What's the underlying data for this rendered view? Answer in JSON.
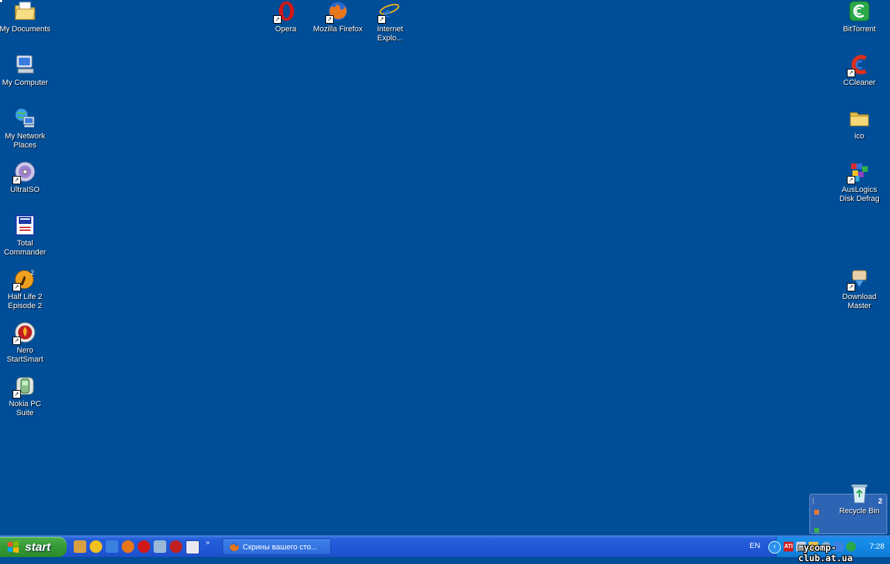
{
  "desktop": {
    "icons_left": [
      {
        "label": "My Documents",
        "icon": "my-documents-icon"
      },
      {
        "label": "My Computer",
        "icon": "my-computer-icon"
      },
      {
        "label": "My Network Places",
        "icon": "network-places-icon"
      },
      {
        "label": "UltraISO",
        "icon": "ultraiso-icon"
      },
      {
        "label": "Total Commander",
        "icon": "total-commander-icon"
      },
      {
        "label": "Half Life 2 Episode 2",
        "icon": "half-life-icon"
      },
      {
        "label": "Nero StartSmart",
        "icon": "nero-icon"
      },
      {
        "label": "Nokia PC Suite",
        "icon": "nokia-icon"
      }
    ],
    "icons_top": [
      {
        "label": "Opera",
        "icon": "opera-icon"
      },
      {
        "label": "Mozilla Firefox",
        "icon": "firefox-icon"
      },
      {
        "label": "Internet Explo...",
        "icon": "internet-explorer-icon"
      }
    ],
    "icons_right": [
      {
        "label": "BitTorrent",
        "icon": "bittorrent-icon"
      },
      {
        "label": "CCleaner",
        "icon": "ccleaner-icon"
      },
      {
        "label": "ico",
        "icon": "folder-icon"
      },
      {
        "label": "AusLogics Disk Defrag",
        "icon": "disk-defrag-icon"
      },
      {
        "label": "Download Master",
        "icon": "download-master-icon"
      },
      {
        "label": "Recycle Bin",
        "icon": "recycle-bin-icon"
      }
    ],
    "widget_count": "2"
  },
  "taskbar": {
    "start_label": "start",
    "task_label": "Скрины вашего сто...",
    "language": "EN",
    "clock": "7:28",
    "tray_ati": "ATI"
  },
  "watermark": "mycomp-club.at.ua",
  "colors": {
    "desktop_bg": "#004e98",
    "taskbar": "#245edb",
    "start_green": "#359a35",
    "tray": "#138ae6"
  }
}
